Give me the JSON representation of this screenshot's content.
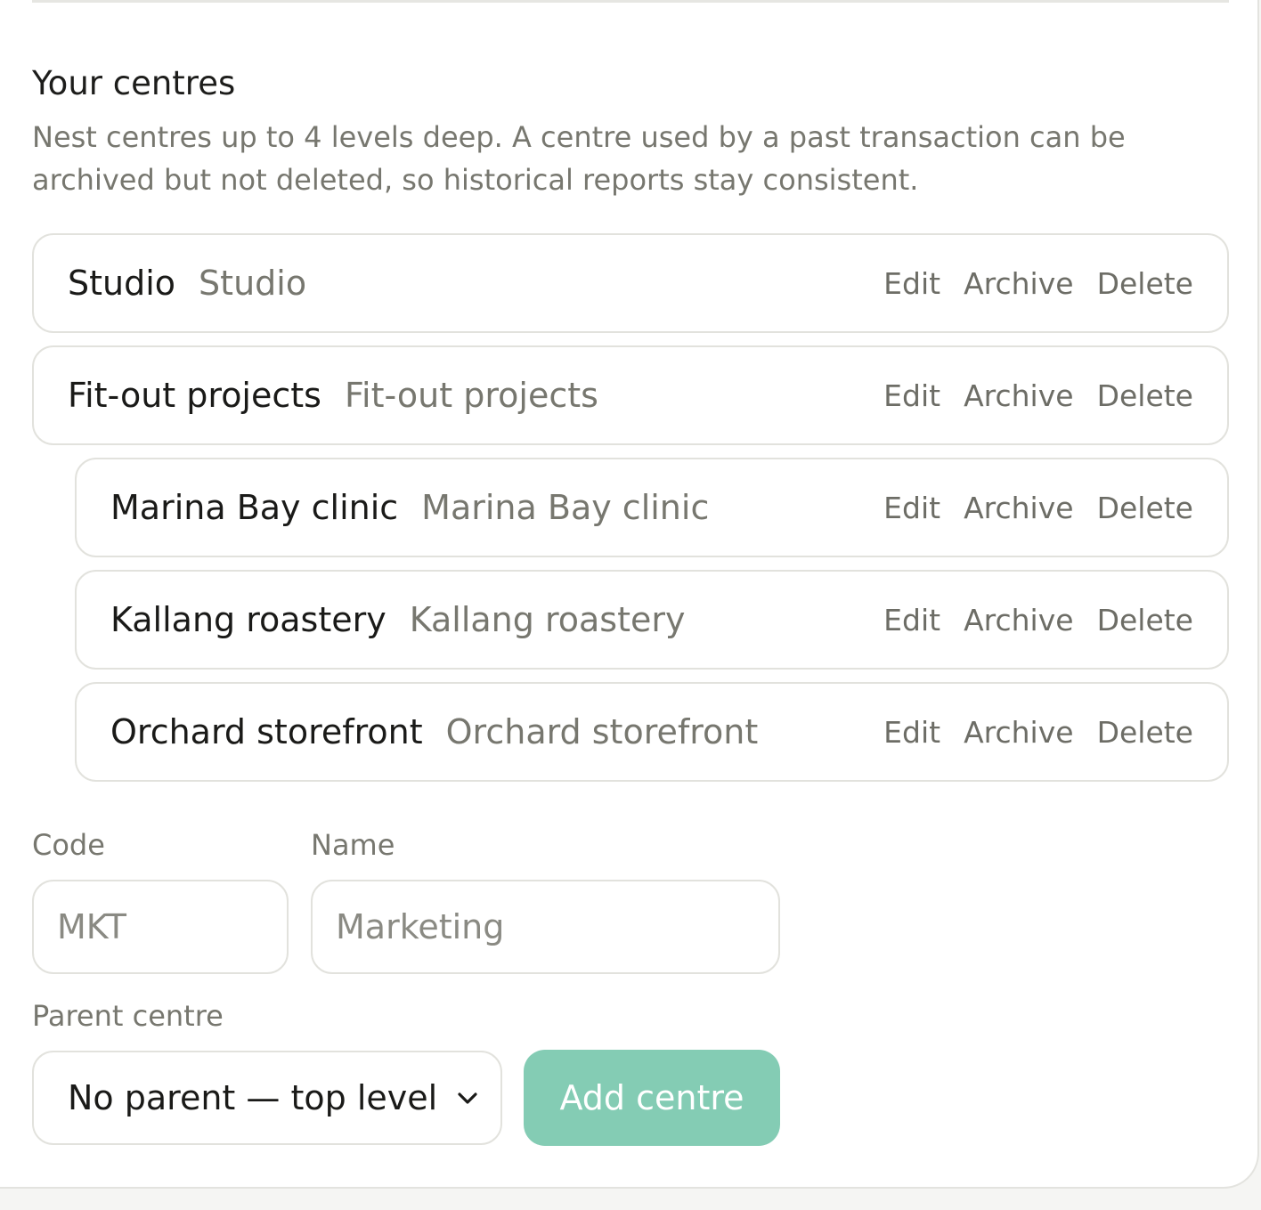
{
  "section": {
    "title": "Your centres",
    "description": "Nest centres up to 4 levels deep. A centre used by a past transaction can be archived but not deleted, so historical reports stay consistent."
  },
  "centres": [
    {
      "code": "Studio",
      "name": "Studio",
      "depth": 0
    },
    {
      "code": "Fit-out projects",
      "name": "Fit-out projects",
      "depth": 0
    },
    {
      "code": "Marina Bay clinic",
      "name": "Marina Bay clinic",
      "depth": 1
    },
    {
      "code": "Kallang roastery",
      "name": "Kallang roastery",
      "depth": 1
    },
    {
      "code": "Orchard storefront",
      "name": "Orchard storefront",
      "depth": 1
    }
  ],
  "row_actions": {
    "edit": "Edit",
    "archive": "Archive",
    "delete": "Delete"
  },
  "form": {
    "code_label": "Code",
    "code_placeholder": "MKT",
    "name_label": "Name",
    "name_placeholder": "Marketing",
    "parent_label": "Parent centre",
    "parent_selected": "No parent — top level",
    "submit_label": "Add centre"
  },
  "icons": {
    "select_chevron": "chevron-down-icon"
  },
  "colors": {
    "accent": "#84ccb4",
    "text_primary": "#1a1a18",
    "text_muted": "#77776f",
    "border": "#e2e2dd"
  }
}
